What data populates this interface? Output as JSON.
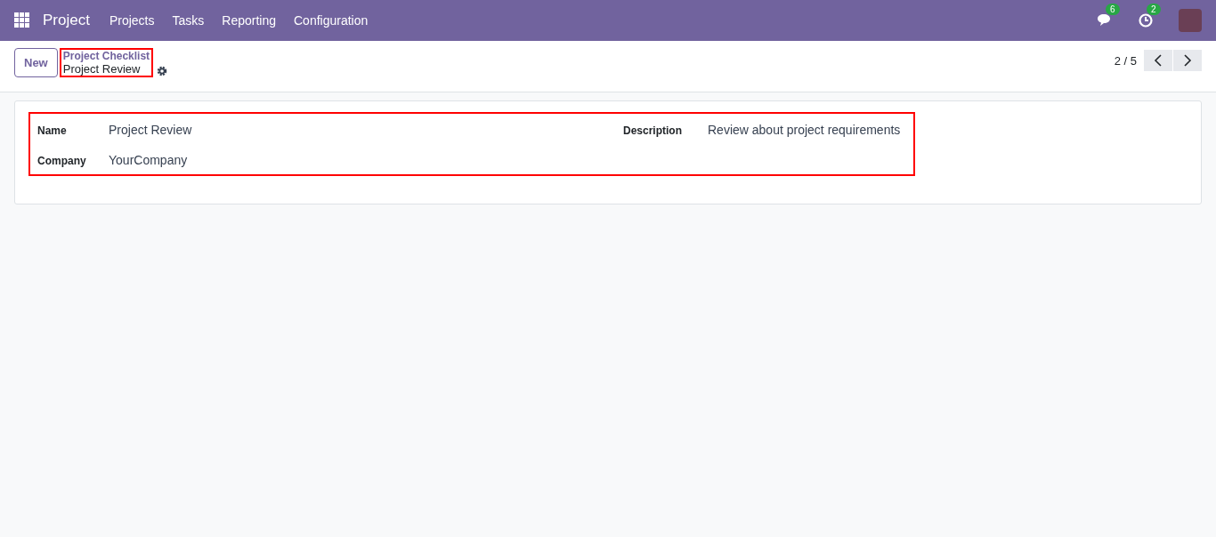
{
  "navbar": {
    "app_name": "Project",
    "menu": [
      "Projects",
      "Tasks",
      "Reporting",
      "Configuration"
    ],
    "messages_count": "6",
    "activities_count": "2"
  },
  "control_panel": {
    "new_button": "New",
    "breadcrumb_parent": "Project Checklist",
    "breadcrumb_current": "Project Review",
    "pager": "2 / 5"
  },
  "form": {
    "left_fields": [
      {
        "label": "Name",
        "value": "Project Review"
      },
      {
        "label": "Company",
        "value": "YourCompany"
      }
    ],
    "right_fields": [
      {
        "label": "Description",
        "value": "Review about project requirements"
      }
    ]
  }
}
